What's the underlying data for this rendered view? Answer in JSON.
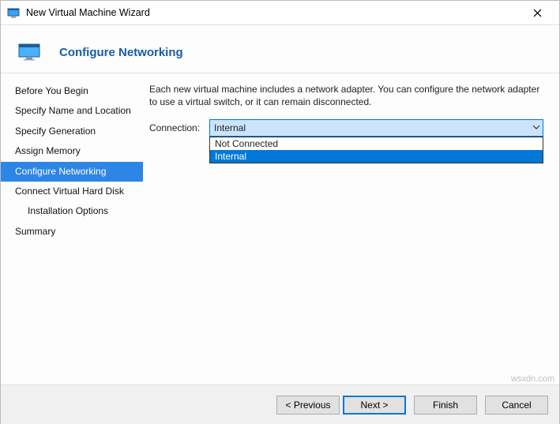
{
  "title": "New Virtual Machine Wizard",
  "heading": "Configure Networking",
  "description": "Each new virtual machine includes a network adapter. You can configure the network adapter to use a virtual switch, or it can remain disconnected.",
  "sidebar": {
    "items": [
      {
        "label": "Before You Begin",
        "selected": false,
        "indent": false
      },
      {
        "label": "Specify Name and Location",
        "selected": false,
        "indent": false
      },
      {
        "label": "Specify Generation",
        "selected": false,
        "indent": false
      },
      {
        "label": "Assign Memory",
        "selected": false,
        "indent": false
      },
      {
        "label": "Configure Networking",
        "selected": true,
        "indent": false
      },
      {
        "label": "Connect Virtual Hard Disk",
        "selected": false,
        "indent": false
      },
      {
        "label": "Installation Options",
        "selected": false,
        "indent": true
      },
      {
        "label": "Summary",
        "selected": false,
        "indent": false
      }
    ]
  },
  "form": {
    "connection_label": "Connection:",
    "connection_value": "Internal",
    "options": [
      {
        "label": "Not Connected",
        "highlight": false
      },
      {
        "label": "Internal",
        "highlight": true
      }
    ]
  },
  "buttons": {
    "previous": "< Previous",
    "next": "Next >",
    "finish": "Finish",
    "cancel": "Cancel"
  },
  "watermark": "wsxdn.com"
}
